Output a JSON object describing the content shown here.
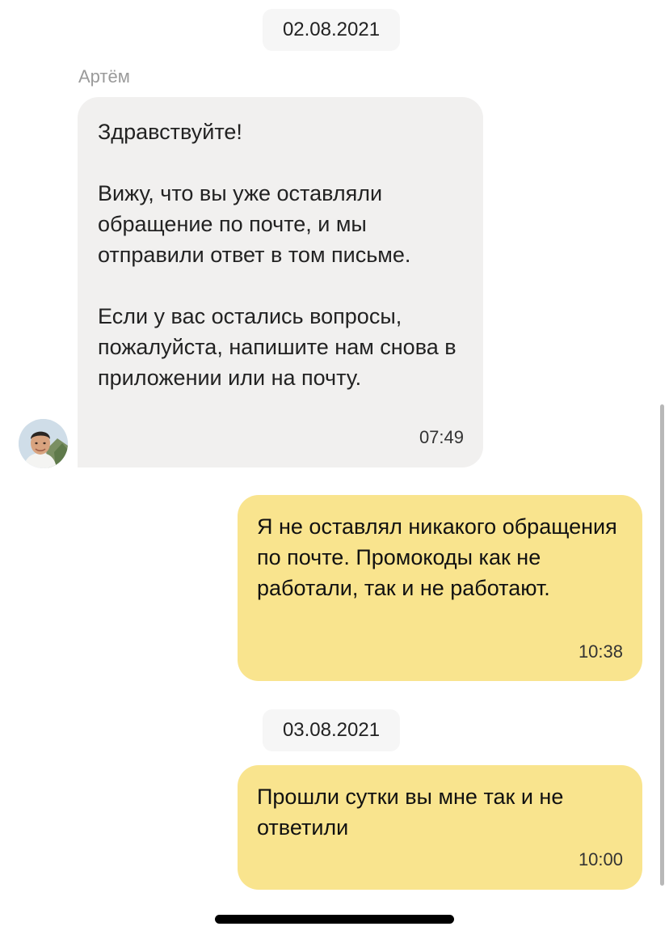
{
  "chat": {
    "date_1": "02.08.2021",
    "date_2": "03.08.2021",
    "incoming": {
      "sender": "Артём",
      "avatar_icon": "user-photo-avatar",
      "paragraphs": [
        "Здравствуйте!",
        "Вижу, что вы уже оставляли обращение по почте, и мы отправили ответ в том письме.",
        "Если у вас остались вопросы, пожалуйста, напишите нам снова в приложении или на почту."
      ],
      "time": "07:49"
    },
    "outgoing": [
      {
        "text": "Я не оставлял никакого обращения по почте. Промокоды как не работали, так и не работают.",
        "time": "10:38"
      },
      {
        "text": "Прошли сутки вы мне так и не ответили",
        "time": "10:00"
      }
    ]
  },
  "colors": {
    "incoming_bubble": "#f1f0ef",
    "outgoing_bubble": "#f9e48e",
    "date_chip": "#f6f6f6"
  }
}
